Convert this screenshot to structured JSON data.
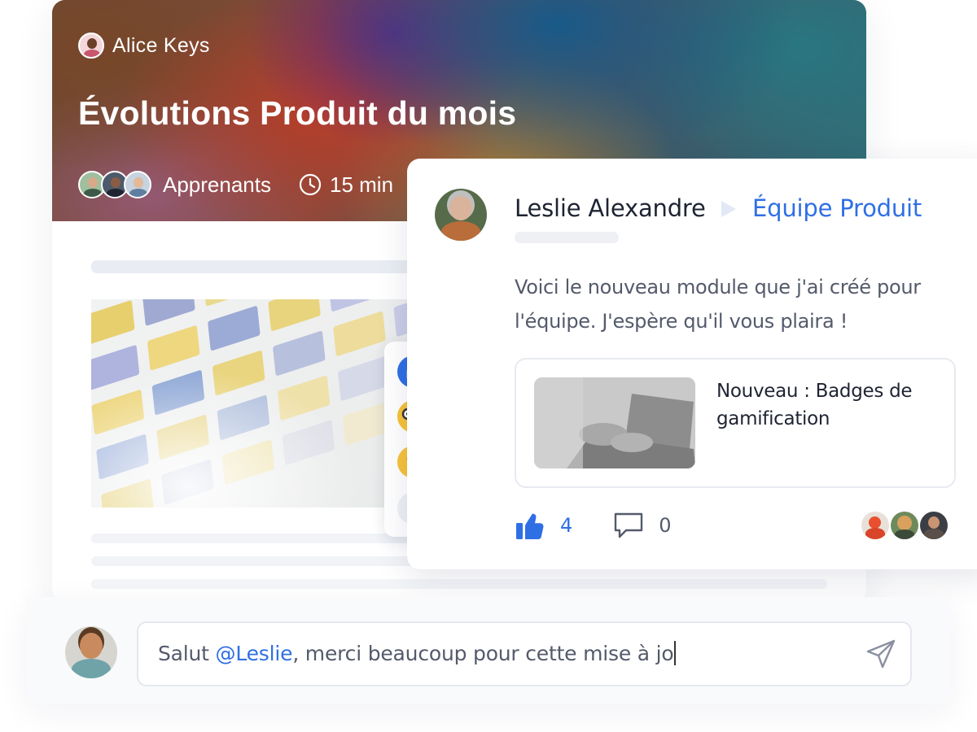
{
  "course": {
    "author": "Alice Keys",
    "title": "Évolutions Produit du mois",
    "learners_label": "Apprenants",
    "duration": "15 min"
  },
  "reactions": [
    "thumbs-up-icon",
    "nerd-face-icon",
    "surprised-face-icon",
    "exclamation-icon"
  ],
  "post": {
    "author": "Leslie Alexandre",
    "team": "Équipe Produit",
    "text": "Voici le nouveau module que j'ai créé pour l'équipe. J'espère qu'il vous plaira !",
    "attachment_title": "Nouveau : Badges de gamification",
    "likes": "4",
    "comments": "0"
  },
  "composer": {
    "prefix": "Salut ",
    "mention": "@Leslie",
    "suffix": ", merci beaucoup pour cette mise à jo"
  },
  "colors": {
    "accent": "#2f6fe4",
    "text_dark": "#1f2433",
    "text_muted": "#545a6b",
    "skeleton": "#e9edf3"
  }
}
